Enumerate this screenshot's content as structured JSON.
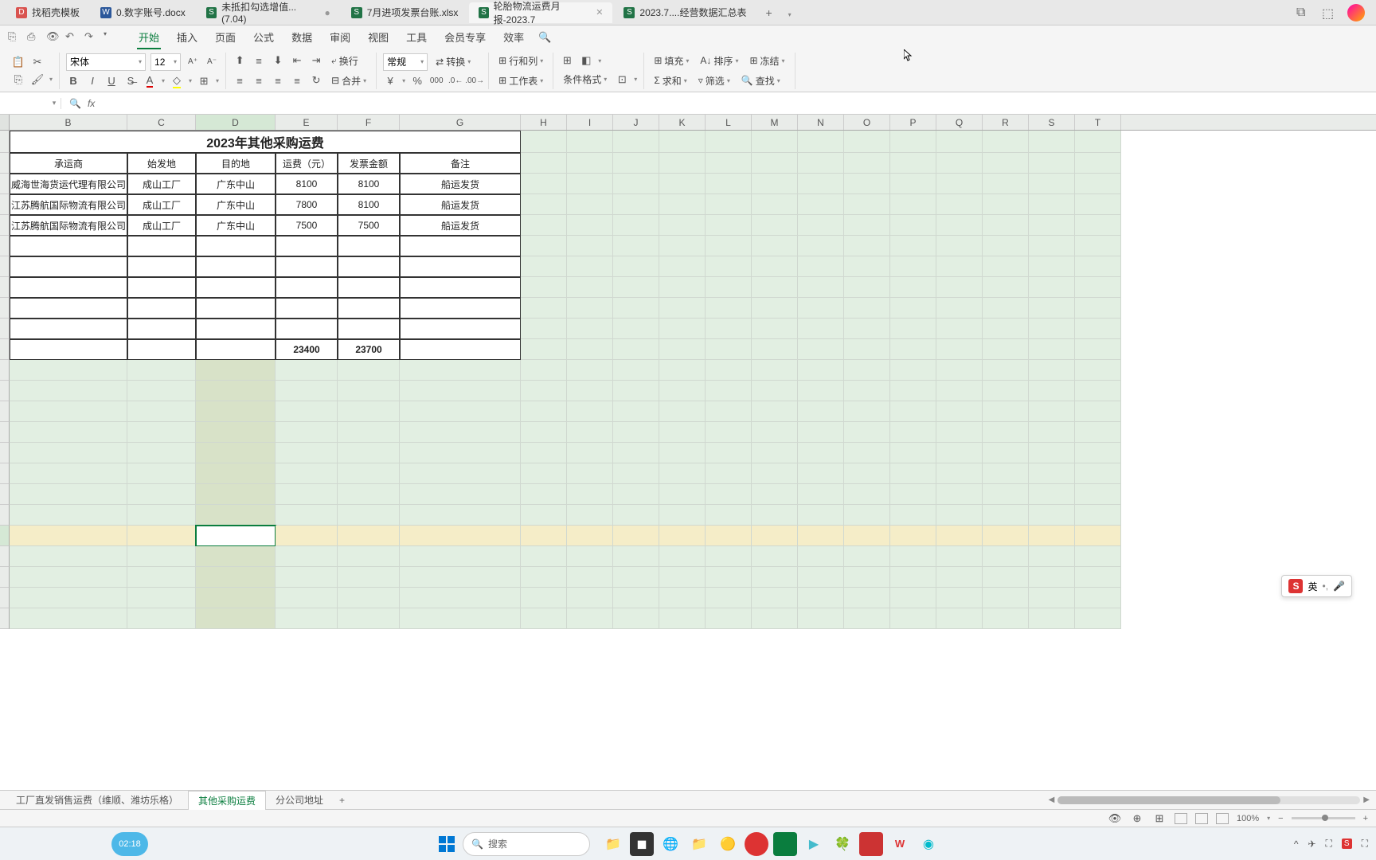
{
  "doc_tabs": [
    {
      "icon": "red",
      "label": "找稻壳模板"
    },
    {
      "icon": "blue",
      "label": "0.数字账号.docx"
    },
    {
      "icon": "green",
      "label": "未抵扣勾选增值... (7.04)",
      "dirty": true
    },
    {
      "icon": "green",
      "label": "7月进项发票台账.xlsx"
    },
    {
      "icon": "green",
      "label": "轮胎物流运费月报-2023.7",
      "active": true,
      "closable": true
    },
    {
      "icon": "green",
      "label": "2023.7....经营数据汇总表"
    }
  ],
  "menu": {
    "items": [
      "开始",
      "插入",
      "页面",
      "公式",
      "数据",
      "审阅",
      "视图",
      "工具",
      "会员专享",
      "效率"
    ],
    "active": "开始"
  },
  "toolbar": {
    "font": "宋体",
    "size": "12",
    "format": "常规",
    "wrap": "换行",
    "merge": "合并",
    "convert": "转换",
    "rowcol": "行和列",
    "sheet": "工作表",
    "condfmt": "条件格式",
    "fill": "填充",
    "sort": "排序",
    "freeze": "冻结",
    "sum": "求和",
    "filter": "筛选",
    "find": "查找"
  },
  "formula": {
    "name": "",
    "fx": "fx"
  },
  "columns": [
    "B",
    "C",
    "D",
    "E",
    "F",
    "G",
    "H",
    "I",
    "J",
    "K",
    "L",
    "M",
    "N",
    "O",
    "P",
    "Q",
    "R",
    "S",
    "T"
  ],
  "title": "2023年其他采购运费",
  "headers": [
    "承运商",
    "始发地",
    "目的地",
    "运费（元）",
    "发票金额",
    "备注"
  ],
  "rows": [
    [
      "威海世海货运代理有限公司",
      "成山工厂",
      "广东中山",
      "8100",
      "8100",
      "船运发货"
    ],
    [
      "江苏腾航国际物流有限公司",
      "成山工厂",
      "广东中山",
      "7800",
      "8100",
      "船运发货"
    ],
    [
      "江苏腾航国际物流有限公司",
      "成山工厂",
      "广东中山",
      "7500",
      "7500",
      "船运发货"
    ]
  ],
  "totals": {
    "e": "23400",
    "f": "23700"
  },
  "sheet_tabs": [
    "工厂直发销售运费（维顺、潍坊乐格）",
    "其他采购运费",
    "分公司地址"
  ],
  "sheet_active": "其他采购运费",
  "status": {
    "zoom": "100%"
  },
  "ime": {
    "label": "英",
    "icons": "•, 🎤"
  },
  "taskbar": {
    "time": "02:18",
    "search": "搜索"
  }
}
